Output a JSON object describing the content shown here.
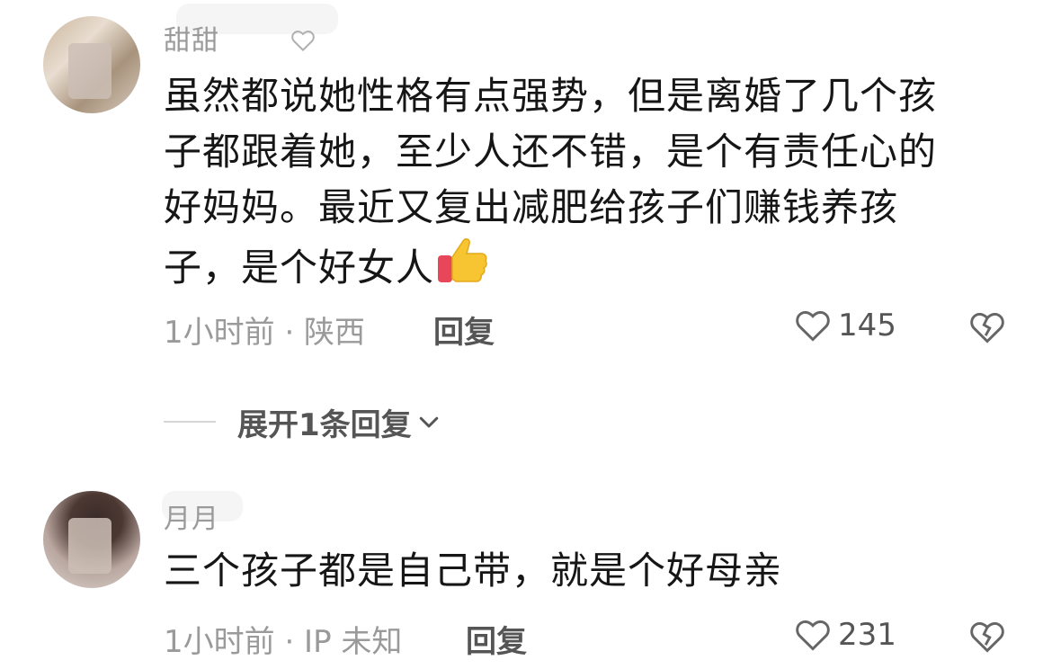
{
  "comments": [
    {
      "username": "甜甜",
      "content_lines": [
        "虽然都说她性格有点强势，但是离婚了几个孩",
        "子都跟着她，至少人还不错，是个有责任心的",
        "好妈妈。最近又复出减肥给孩子们赚钱养孩",
        "子，是个好女人"
      ],
      "emoji": "thumbs-up-icon",
      "meta": "1小时前 · 陕西",
      "reply_label": "回复",
      "likes": "145"
    },
    {
      "username": "月月",
      "content_lines": [
        "三个孩子都是自己带，就是个好母亲"
      ],
      "meta": "1小时前 · IP 未知",
      "reply_label": "回复",
      "likes": "231"
    }
  ],
  "expand_replies": {
    "label": "展开1条回复"
  },
  "colors": {
    "text": "#161616",
    "meta": "#9a9a9a",
    "action": "#555555"
  }
}
